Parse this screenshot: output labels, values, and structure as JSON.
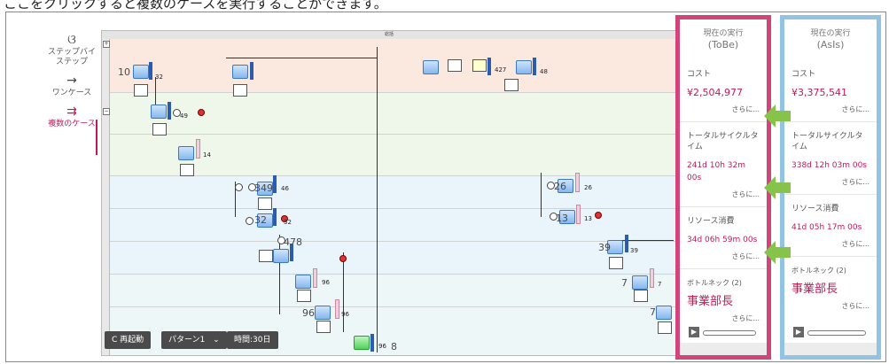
{
  "caption": "ここをクリックすると複数のケースを実行することができます。",
  "nav": {
    "modes": [
      {
        "label": "ステップバイステップ",
        "icon": "step-icon"
      },
      {
        "label": "ワンケース",
        "icon": "arrow-right-icon"
      },
      {
        "label": "複数のケース",
        "icon": "multi-arrow-icon"
      }
    ]
  },
  "canvas": {
    "title": "総括",
    "node_counts": [
      "10",
      "32",
      "49",
      "14",
      "349",
      "46",
      "32",
      "32",
      "478",
      "96",
      "96",
      "96",
      "96",
      "8",
      "427",
      "48",
      "26",
      "26",
      "13",
      "13",
      "39",
      "39",
      "7",
      "7",
      "7"
    ]
  },
  "controls": {
    "restart": "C 再起動",
    "pattern": "パターン1",
    "time": "時間:30日"
  },
  "panels": [
    {
      "title": "現在の実行",
      "sub": "(ToBe)",
      "cost_label": "コスト",
      "cost_value": "¥2,504,977",
      "cycle_label": "トータルサイクルタイム",
      "cycle_value": "241d 10h 32m 00s",
      "resource_label": "リソース消費",
      "resource_value": "34d 06h 59m 00s",
      "bottleneck_label": "ボトルネック (2)",
      "bottleneck_value": "事業部長",
      "more": "さらに..."
    },
    {
      "title": "現在の実行",
      "sub": "(AsIs)",
      "cost_label": "コスト",
      "cost_value": "¥3,375,541",
      "cycle_label": "トータルサイクルタイム",
      "cycle_value": "338d 12h 03m 00s",
      "resource_label": "リソース消費",
      "resource_value": "41d 05h 17m 00s",
      "bottleneck_label": "ボトルネック (2)",
      "bottleneck_value": "事業部長",
      "more": "さらに..."
    }
  ],
  "colors": {
    "tobe_border": "#d0467b",
    "asis_border": "#93c3e3",
    "accent": "#c2185b",
    "arrow": "#86c34a"
  }
}
